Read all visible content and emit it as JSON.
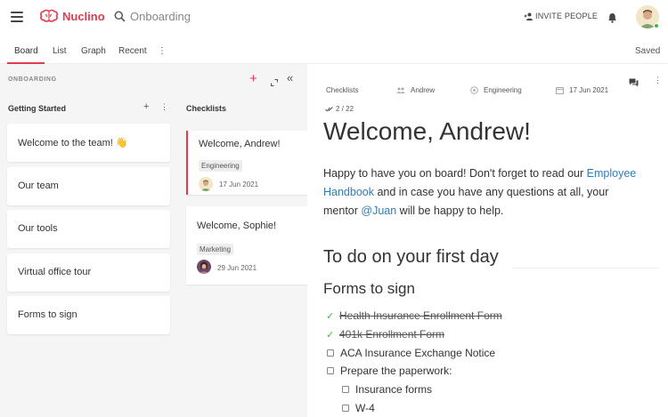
{
  "header": {
    "app_name": "Nuclino",
    "search_placeholder": "Onboarding",
    "invite_label": "INVITE PEOPLE"
  },
  "tabs": [
    {
      "label": "Board"
    },
    {
      "label": "List"
    },
    {
      "label": "Graph"
    },
    {
      "label": "Recent"
    }
  ],
  "tabs_more": "⋮",
  "status": "Saved",
  "board": {
    "title": "ONBOARDING",
    "columns": [
      {
        "name": "Getting Started",
        "cards": [
          "Welcome to the team! 👋",
          "Our team",
          "Our tools",
          "Virtual office tour",
          "Forms to sign"
        ]
      },
      {
        "name": "Checklists",
        "cards": [
          {
            "title": "Welcome, Andrew!",
            "tag": "Engineering",
            "date": "17 Jun 2021"
          },
          {
            "title": "Welcome, Sophie!",
            "tag": "Marketing",
            "date": "29 Jun 2021"
          }
        ]
      }
    ]
  },
  "doc": {
    "meta": {
      "collection": "Checklists",
      "assignee": "Andrew",
      "team": "Engineering",
      "date": "17 Jun 2021"
    },
    "progress": "2 / 22",
    "title": "Welcome, Andrew!",
    "intro": {
      "p1": "Happy to have you on board! Don't forget to read our ",
      "link1": "Employee Handbook",
      "p2": " and in case you have any questions at all, your mentor ",
      "mention": "@Juan",
      "p3": " will be happy to help."
    },
    "section": "To do on your first day",
    "subsection": "Forms to sign",
    "todos": [
      {
        "text": "Health Insurance Enrollment Form",
        "done": true
      },
      {
        "text": "401k Enrollment Form",
        "done": true
      },
      {
        "text": "ACA Insurance Exchange Notice",
        "done": false
      },
      {
        "text": "Prepare the paperwork:",
        "done": false
      },
      {
        "text": "Insurance forms",
        "done": false
      },
      {
        "text": "W-4",
        "done": false
      }
    ]
  },
  "colors": {
    "accent": "#e23b4e",
    "link": "#2f7db5",
    "check": "#4caf50"
  }
}
